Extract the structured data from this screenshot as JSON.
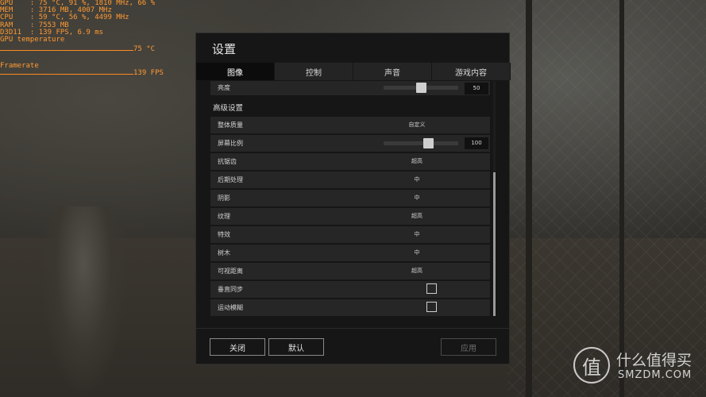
{
  "overlay": {
    "gpu": "GPU    : 75 °C, 91 %, 1810 MHz, 66 %",
    "mem": "MEM    : 3716 MB, 4007 MHz",
    "cpu": "CPU    : 59 °C, 56 %, 4499 MHz",
    "ram": "RAM    : 7553 MB",
    "d3d": "D3D11  : 139 FPS, 6.9 ms",
    "gpu_temp_label": "GPU temperature",
    "gpu_temp_value": "75 °C",
    "framerate_label": "Framerate",
    "framerate_value": "139 FPS",
    "color": "#ff9a33"
  },
  "window": {
    "title": "设置",
    "tabs": [
      {
        "label": "图像",
        "active": true
      },
      {
        "label": "控制",
        "active": false
      },
      {
        "label": "声音",
        "active": false
      },
      {
        "label": "游戏内容",
        "active": false
      }
    ],
    "brightness": {
      "label": "亮度",
      "value": "50",
      "level": 0.5
    },
    "section_title": "高级设置",
    "rows": [
      {
        "label": "整体质量",
        "value": "自定义"
      },
      {
        "label": "屏幕比例",
        "value": "100",
        "level": 0.6
      },
      {
        "label": "抗锯齿",
        "value": "超高"
      },
      {
        "label": "后期处理",
        "value": "中"
      },
      {
        "label": "阴影",
        "value": "中"
      },
      {
        "label": "纹理",
        "value": "超高"
      },
      {
        "label": "特效",
        "value": "中"
      },
      {
        "label": "树木",
        "value": "中"
      },
      {
        "label": "可视距离",
        "value": "超高"
      },
      {
        "label": "垂直同步",
        "checked": false
      },
      {
        "label": "运动模糊",
        "checked": false
      }
    ],
    "buttons": {
      "close": "关闭",
      "default": "默认",
      "apply": "应用"
    }
  },
  "watermark": {
    "logo_char": "值",
    "cn": "什么值得买",
    "en": "SMZDM.COM"
  }
}
